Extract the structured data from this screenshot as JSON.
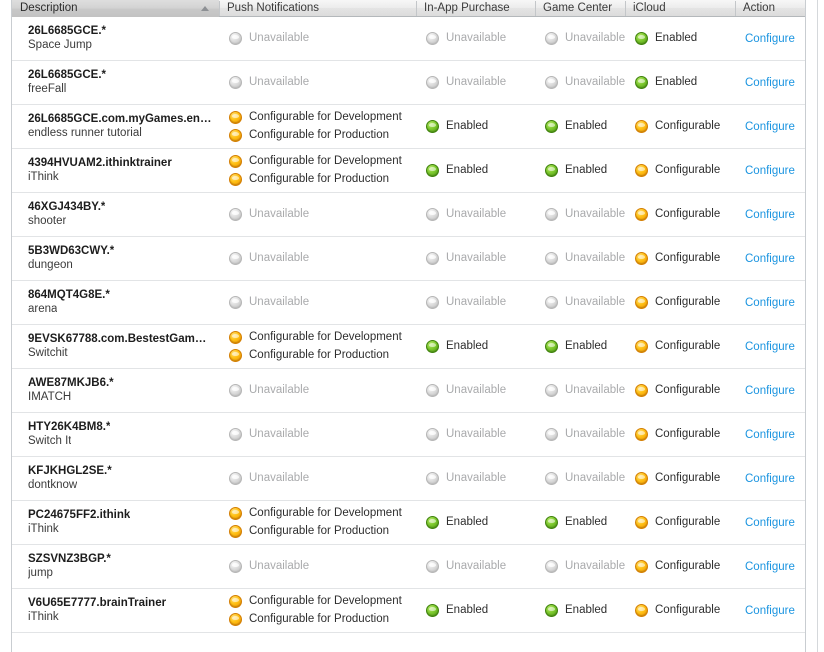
{
  "table": {
    "columns": [
      {
        "key": "description",
        "label": "Description",
        "sorted": true,
        "sort_direction": "asc"
      },
      {
        "key": "push",
        "label": "Push Notifications",
        "sorted": false
      },
      {
        "key": "iap",
        "label": "In-App Purchase",
        "sorted": false
      },
      {
        "key": "gamecenter",
        "label": "Game Center",
        "sorted": false
      },
      {
        "key": "icloud",
        "label": "iCloud",
        "sorted": false
      },
      {
        "key": "action",
        "label": "Action",
        "sorted": false
      }
    ],
    "status_text": {
      "unavailable": "Unavailable",
      "enabled": "Enabled",
      "configurable": "Configurable",
      "configurable_development": "Configurable for Development",
      "configurable_production": "Configurable for Production"
    },
    "action_label": "Configure",
    "colors": {
      "link": "#1a94e0",
      "orb_green": "#7dc92e",
      "orb_amber": "#ffc013",
      "orb_gray": "#dddddd",
      "header_sorted_bg": "#d2d2d2",
      "row_border": "#e2e4e6"
    },
    "rows": [
      {
        "id": "26L6685GCE.*",
        "name": "Space Jump",
        "push": [
          {
            "state": "gray",
            "label": "Unavailable",
            "muted": true
          }
        ],
        "iap": [
          {
            "state": "gray",
            "label": "Unavailable",
            "muted": true
          }
        ],
        "gamecenter": [
          {
            "state": "gray",
            "label": "Unavailable",
            "muted": true
          }
        ],
        "icloud": [
          {
            "state": "green",
            "label": "Enabled",
            "muted": false
          }
        ],
        "action": "Configure"
      },
      {
        "id": "26L6685GCE.*",
        "name": "freeFall",
        "push": [
          {
            "state": "gray",
            "label": "Unavailable",
            "muted": true
          }
        ],
        "iap": [
          {
            "state": "gray",
            "label": "Unavailable",
            "muted": true
          }
        ],
        "gamecenter": [
          {
            "state": "gray",
            "label": "Unavailable",
            "muted": true
          }
        ],
        "icloud": [
          {
            "state": "green",
            "label": "Enabled",
            "muted": false
          }
        ],
        "action": "Configure"
      },
      {
        "id": "26L6685GCE.com.myGames.en…",
        "name": "endless runner tutorial",
        "push": [
          {
            "state": "amber",
            "label": "Configurable for Development",
            "muted": false
          },
          {
            "state": "amber",
            "label": "Configurable for Production",
            "muted": false
          }
        ],
        "iap": [
          {
            "state": "green",
            "label": "Enabled",
            "muted": false
          }
        ],
        "gamecenter": [
          {
            "state": "green",
            "label": "Enabled",
            "muted": false
          }
        ],
        "icloud": [
          {
            "state": "amber",
            "label": "Configurable",
            "muted": false
          }
        ],
        "action": "Configure"
      },
      {
        "id": "4394HVUAM2.ithinktrainer",
        "name": "iThink",
        "push": [
          {
            "state": "amber",
            "label": "Configurable for Development",
            "muted": false
          },
          {
            "state": "amber",
            "label": "Configurable for Production",
            "muted": false
          }
        ],
        "iap": [
          {
            "state": "green",
            "label": "Enabled",
            "muted": false
          }
        ],
        "gamecenter": [
          {
            "state": "green",
            "label": "Enabled",
            "muted": false
          }
        ],
        "icloud": [
          {
            "state": "amber",
            "label": "Configurable",
            "muted": false
          }
        ],
        "action": "Configure"
      },
      {
        "id": "46XGJ434BY.*",
        "name": "shooter",
        "push": [
          {
            "state": "gray",
            "label": "Unavailable",
            "muted": true
          }
        ],
        "iap": [
          {
            "state": "gray",
            "label": "Unavailable",
            "muted": true
          }
        ],
        "gamecenter": [
          {
            "state": "gray",
            "label": "Unavailable",
            "muted": true
          }
        ],
        "icloud": [
          {
            "state": "amber",
            "label": "Configurable",
            "muted": false
          }
        ],
        "action": "Configure"
      },
      {
        "id": "5B3WD63CWY.*",
        "name": "dungeon",
        "push": [
          {
            "state": "gray",
            "label": "Unavailable",
            "muted": true
          }
        ],
        "iap": [
          {
            "state": "gray",
            "label": "Unavailable",
            "muted": true
          }
        ],
        "gamecenter": [
          {
            "state": "gray",
            "label": "Unavailable",
            "muted": true
          }
        ],
        "icloud": [
          {
            "state": "amber",
            "label": "Configurable",
            "muted": false
          }
        ],
        "action": "Configure"
      },
      {
        "id": "864MQT4G8E.*",
        "name": "arena",
        "push": [
          {
            "state": "gray",
            "label": "Unavailable",
            "muted": true
          }
        ],
        "iap": [
          {
            "state": "gray",
            "label": "Unavailable",
            "muted": true
          }
        ],
        "gamecenter": [
          {
            "state": "gray",
            "label": "Unavailable",
            "muted": true
          }
        ],
        "icloud": [
          {
            "state": "amber",
            "label": "Configurable",
            "muted": false
          }
        ],
        "action": "Configure"
      },
      {
        "id": "9EVSK67788.com.BestestGam…",
        "name": "Switchit",
        "push": [
          {
            "state": "amber",
            "label": "Configurable for Development",
            "muted": false
          },
          {
            "state": "amber",
            "label": "Configurable for Production",
            "muted": false
          }
        ],
        "iap": [
          {
            "state": "green",
            "label": "Enabled",
            "muted": false
          }
        ],
        "gamecenter": [
          {
            "state": "green",
            "label": "Enabled",
            "muted": false
          }
        ],
        "icloud": [
          {
            "state": "amber",
            "label": "Configurable",
            "muted": false
          }
        ],
        "action": "Configure"
      },
      {
        "id": "AWE87MKJB6.*",
        "name": "IMATCH",
        "push": [
          {
            "state": "gray",
            "label": "Unavailable",
            "muted": true
          }
        ],
        "iap": [
          {
            "state": "gray",
            "label": "Unavailable",
            "muted": true
          }
        ],
        "gamecenter": [
          {
            "state": "gray",
            "label": "Unavailable",
            "muted": true
          }
        ],
        "icloud": [
          {
            "state": "amber",
            "label": "Configurable",
            "muted": false
          }
        ],
        "action": "Configure"
      },
      {
        "id": "HTY26K4BM8.*",
        "name": "Switch It",
        "push": [
          {
            "state": "gray",
            "label": "Unavailable",
            "muted": true
          }
        ],
        "iap": [
          {
            "state": "gray",
            "label": "Unavailable",
            "muted": true
          }
        ],
        "gamecenter": [
          {
            "state": "gray",
            "label": "Unavailable",
            "muted": true
          }
        ],
        "icloud": [
          {
            "state": "amber",
            "label": "Configurable",
            "muted": false
          }
        ],
        "action": "Configure"
      },
      {
        "id": "KFJKHGL2SE.*",
        "name": "dontknow",
        "push": [
          {
            "state": "gray",
            "label": "Unavailable",
            "muted": true
          }
        ],
        "iap": [
          {
            "state": "gray",
            "label": "Unavailable",
            "muted": true
          }
        ],
        "gamecenter": [
          {
            "state": "gray",
            "label": "Unavailable",
            "muted": true
          }
        ],
        "icloud": [
          {
            "state": "amber",
            "label": "Configurable",
            "muted": false
          }
        ],
        "action": "Configure"
      },
      {
        "id": "PC24675FF2.ithink",
        "name": "iThink",
        "push": [
          {
            "state": "amber",
            "label": "Configurable for Development",
            "muted": false
          },
          {
            "state": "amber",
            "label": "Configurable for Production",
            "muted": false
          }
        ],
        "iap": [
          {
            "state": "green",
            "label": "Enabled",
            "muted": false
          }
        ],
        "gamecenter": [
          {
            "state": "green",
            "label": "Enabled",
            "muted": false
          }
        ],
        "icloud": [
          {
            "state": "amber",
            "label": "Configurable",
            "muted": false
          }
        ],
        "action": "Configure"
      },
      {
        "id": "SZSVNZ3BGP.*",
        "name": "jump",
        "push": [
          {
            "state": "gray",
            "label": "Unavailable",
            "muted": true
          }
        ],
        "iap": [
          {
            "state": "gray",
            "label": "Unavailable",
            "muted": true
          }
        ],
        "gamecenter": [
          {
            "state": "gray",
            "label": "Unavailable",
            "muted": true
          }
        ],
        "icloud": [
          {
            "state": "amber",
            "label": "Configurable",
            "muted": false
          }
        ],
        "action": "Configure"
      },
      {
        "id": "V6U65E7777.brainTrainer",
        "name": "iThink",
        "push": [
          {
            "state": "amber",
            "label": "Configurable for Development",
            "muted": false
          },
          {
            "state": "amber",
            "label": "Configurable for Production",
            "muted": false
          }
        ],
        "iap": [
          {
            "state": "green",
            "label": "Enabled",
            "muted": false
          }
        ],
        "gamecenter": [
          {
            "state": "green",
            "label": "Enabled",
            "muted": false
          }
        ],
        "icloud": [
          {
            "state": "amber",
            "label": "Configurable",
            "muted": false
          }
        ],
        "action": "Configure"
      }
    ]
  }
}
